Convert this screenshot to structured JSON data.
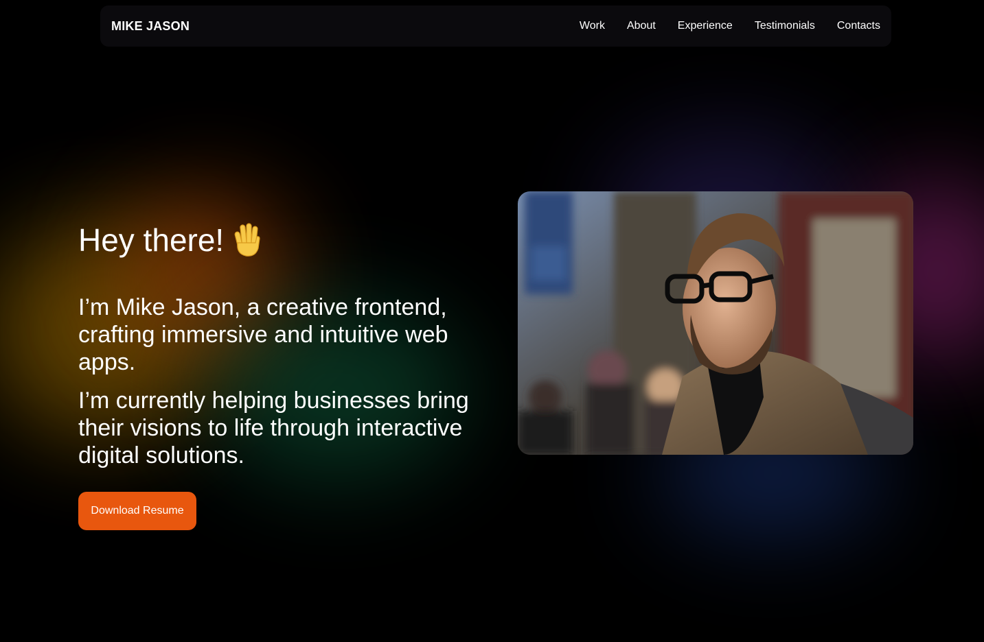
{
  "nav": {
    "logo": "MIKE JASON",
    "links": [
      "Work",
      "About",
      "Experience",
      "Testimonials",
      "Contacts"
    ]
  },
  "hero": {
    "greeting": "Hey there!",
    "greeting_icon": "waving-hand-icon",
    "intro": "I’m Mike Jason, a creative frontend, crafting immersive and intuitive web apps.",
    "current": "I’m currently helping businesses bring their visions to life through interactive digital solutions.",
    "button_label": "Download Resume",
    "photo": "portrait-photo"
  },
  "colors": {
    "background": "#000000",
    "nav_background": "#0b0a0d",
    "accent": "#e8570e",
    "text": "#ffffff"
  }
}
